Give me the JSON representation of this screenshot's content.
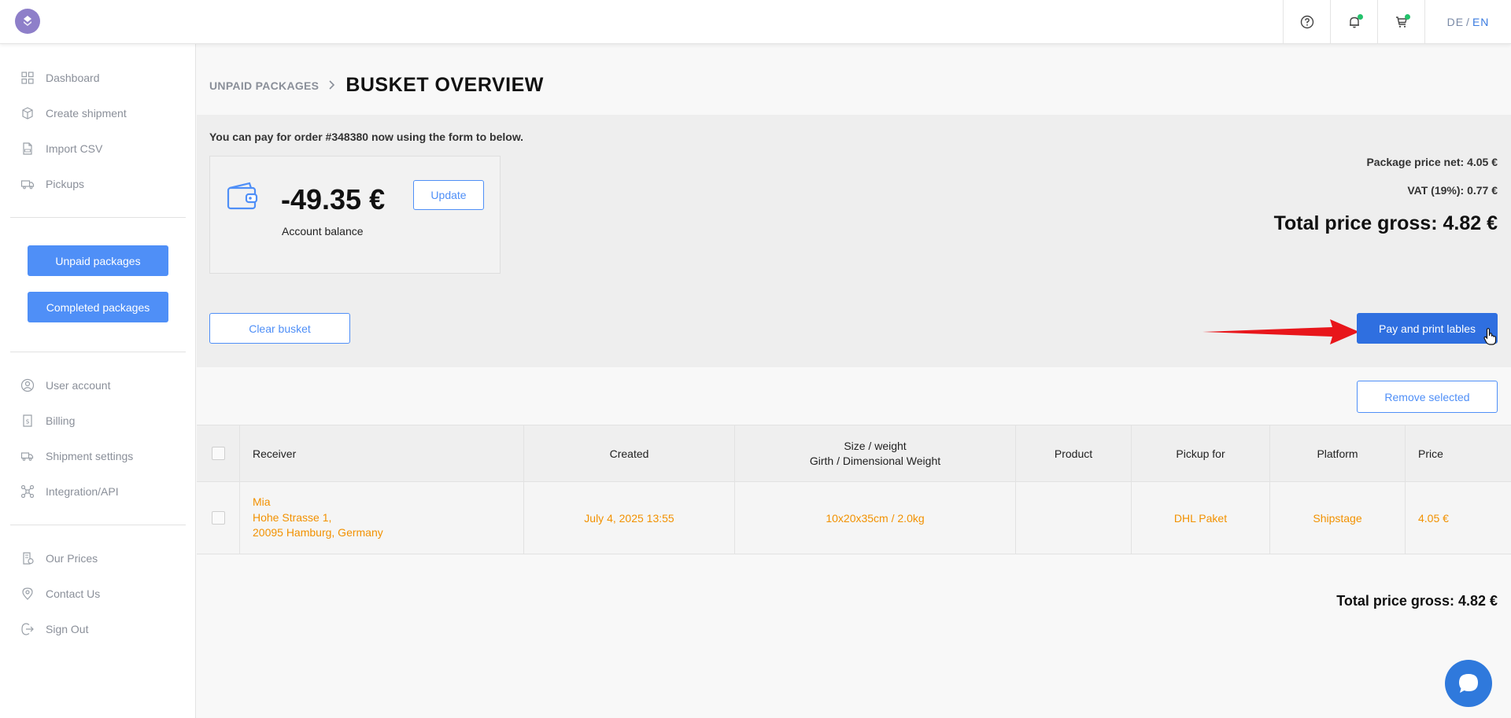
{
  "topbar": {
    "lang_de": "DE",
    "lang_sep": "/",
    "lang_en": "EN",
    "icons": [
      "help-icon",
      "bell-icon",
      "cart-icon"
    ]
  },
  "sidebar": {
    "items_top": [
      {
        "label": "Dashboard",
        "icon": "dashboard-icon"
      },
      {
        "label": "Create shipment",
        "icon": "box-icon"
      },
      {
        "label": "Import CSV",
        "icon": "csv-file-icon"
      },
      {
        "label": "Pickups",
        "icon": "truck-icon"
      }
    ],
    "unpaid_label": "Unpaid packages",
    "completed_label": "Completed packages",
    "items_mid": [
      {
        "label": "User account",
        "icon": "user-icon"
      },
      {
        "label": "Billing",
        "icon": "billing-icon"
      },
      {
        "label": "Shipment settings",
        "icon": "shipment-settings-icon"
      },
      {
        "label": "Integration/API",
        "icon": "integration-icon"
      }
    ],
    "items_bottom": [
      {
        "label": "Our Prices",
        "icon": "prices-icon"
      },
      {
        "label": "Contact Us",
        "icon": "location-pin-icon"
      },
      {
        "label": "Sign Out",
        "icon": "sign-out-icon"
      }
    ]
  },
  "breadcrumb": {
    "parent": "UNPAID PACKAGES",
    "current": "BUSKET OVERVIEW"
  },
  "payment": {
    "note": "You can pay for order #348380 now using the form to below.",
    "balance_amount": "-49.35 €",
    "balance_label": "Account balance",
    "update_label": "Update",
    "price_net": "Package price net: 4.05 €",
    "vat": "VAT (19%): 0.77 €",
    "total": "Total price gross: 4.82 €",
    "clear_label": "Clear busket",
    "pay_label": "Pay and print lables"
  },
  "remove_label": "Remove selected",
  "table": {
    "headers": {
      "receiver": "Receiver",
      "created": "Created",
      "size_line1": "Size / weight",
      "size_line2": "Girth / Dimensional Weight",
      "product": "Product",
      "pickup": "Pickup for",
      "platform": "Platform",
      "price": "Price"
    },
    "rows": [
      {
        "receiver_name": "Mia",
        "receiver_street": "Hohe Strasse 1,",
        "receiver_city": "20095 Hamburg, Germany",
        "created": "July 4, 2025 13:55",
        "size": "10x20x35cm / 2.0kg",
        "product": "",
        "pickup": "DHL Paket",
        "platform": "Shipstage",
        "price": "4.05 €"
      }
    ]
  },
  "bottom_total": "Total price gross: 4.82 €",
  "colors": {
    "primary": "#4f8ff7",
    "primary_dark": "#2f6fe0",
    "row_text": "#f29100",
    "arrow": "#e8161b"
  }
}
